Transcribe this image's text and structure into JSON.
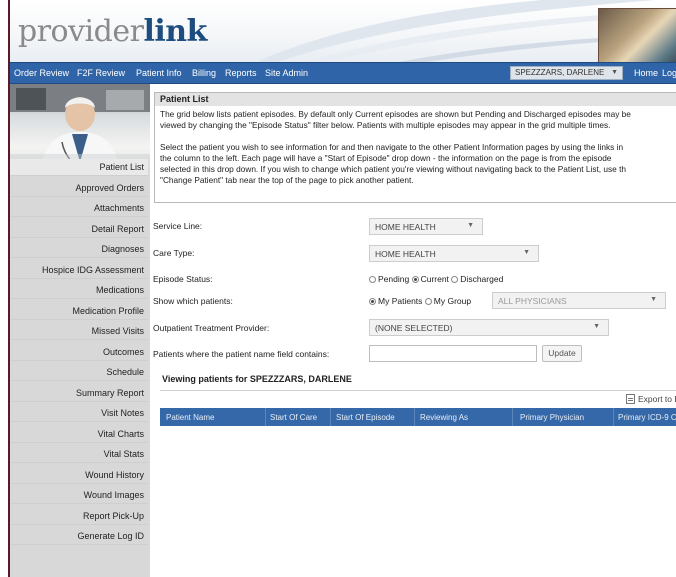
{
  "logo": {
    "part1": "provider",
    "part2": "link"
  },
  "nav": {
    "items": [
      "Order Review",
      "F2F Review",
      "Patient Info",
      "Billing",
      "Reports",
      "Site Admin"
    ],
    "patient_select": "SPEZZZARS, DARLENE",
    "home": "Home",
    "logout": "Log"
  },
  "sidebar": {
    "items": [
      "Patient List",
      "Approved Orders",
      "Attachments",
      "Detail Report",
      "Diagnoses",
      "Hospice IDG Assessment",
      "Medications",
      "Medication Profile",
      "Missed Visits",
      "Outcomes",
      "Schedule",
      "Summary Report",
      "Visit Notes",
      "Vital Charts",
      "Vital Stats",
      "Wound History",
      "Wound Images",
      "Report Pick-Up",
      "Generate Log ID"
    ]
  },
  "info": {
    "title": "Patient List",
    "lines": [
      "The grid below lists patient episodes. By default only Current episodes are shown but Pending and Discharged episodes may be",
      "viewed by changing the \"Episode Status\" filter below.  Patients with multiple episodes may appear in the grid multiple times.",
      "",
      "Select the patient you wish to see information for and then navigate to the other Patient Information pages by using the links in",
      "the column to the left.  Each page will have a \"Start of Episode\" drop down - the information on the page is from the episode",
      "selected in this drop down. If you wish to change which patient you're viewing without navigating back to the Patient List, use th",
      "\"Change Patient\" tab near the top of the page to pick another patient."
    ]
  },
  "form": {
    "service_line_label": "Service Line:",
    "service_line_value": "HOME HEALTH",
    "care_type_label": "Care Type:",
    "care_type_value": "HOME HEALTH",
    "episode_status_label": "Episode Status:",
    "episode_options": [
      "Pending",
      "Current",
      "Discharged"
    ],
    "episode_selected": "Current",
    "show_patients_label": "Show which patients:",
    "show_options": [
      "My Patients",
      "My Group"
    ],
    "show_selected": "My Patients",
    "physicians_value": "ALL PHYSICIANS",
    "outpatient_label": "Outpatient Treatment Provider:",
    "outpatient_value": "(NONE SELECTED)",
    "name_filter_label": "Patients where the patient name field contains:",
    "name_filter_value": "",
    "update_label": "Update"
  },
  "grid": {
    "viewing_text": "Viewing patients for SPEZZZARS, DARLENE",
    "export_label": "Export to Ex",
    "columns": [
      "Patient Name",
      "Start Of Care",
      "Start Of Episode",
      "Reviewing As",
      "Primary Physician",
      "Primary ICD-9 Co"
    ]
  }
}
